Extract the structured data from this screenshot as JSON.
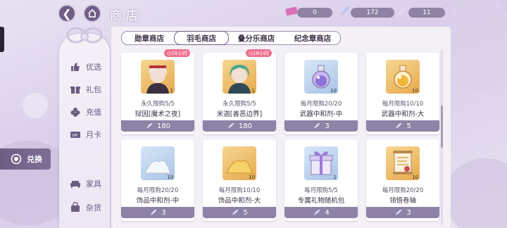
{
  "header": {
    "title": "商店",
    "currencies": [
      {
        "icon": "ticket-icon",
        "value": "0"
      },
      {
        "icon": "feather-icon",
        "value": "172"
      },
      {
        "icon": "star-feather-icon",
        "value": "11"
      }
    ]
  },
  "nav": {
    "items": [
      {
        "label": "优选",
        "icon": "thumb-up-icon"
      },
      {
        "label": "礼包",
        "icon": "gift-icon"
      },
      {
        "label": "充值",
        "icon": "flower-icon"
      },
      {
        "label": "月卡",
        "icon": "vip-card-icon"
      },
      {
        "label": "兑换",
        "icon": "exchange-icon"
      },
      {
        "label": "家具",
        "icon": "sofa-icon"
      },
      {
        "label": "杂货",
        "icon": "bag-icon"
      }
    ],
    "active": "兑换"
  },
  "tabs": [
    "勋章商店",
    "羽毛商店",
    "叠分乐商店",
    "纪念章商店"
  ],
  "active_tab": "羽毛商店",
  "items": [
    {
      "name": "狱因[魔术之夜]",
      "limit": "永久限购5/5",
      "price": "180",
      "qty": "1",
      "badge": "18小时",
      "thumb_icon": "character-portrait-red-icon"
    },
    {
      "name": "米迦[善恶边界]",
      "limit": "永久限购5/5",
      "price": "180",
      "qty": "1",
      "badge": "18小时",
      "thumb_icon": "character-portrait-green-icon"
    },
    {
      "name": "武器中和剂-中",
      "limit": "每月限购20/20",
      "price": "3",
      "qty": "10",
      "badge": "",
      "thumb_icon": "potion-purple-icon"
    },
    {
      "name": "武器中和剂-大",
      "limit": "每月限购10/10",
      "price": "5",
      "qty": "10",
      "badge": "",
      "thumb_icon": "potion-gold-icon"
    },
    {
      "name": "饰品中和剂-中",
      "limit": "每月限购20/20",
      "price": "3",
      "qty": "10",
      "badge": "",
      "thumb_icon": "powder-white-icon"
    },
    {
      "name": "饰品中和剂-大",
      "limit": "每月限购10/10",
      "price": "5",
      "qty": "10",
      "badge": "",
      "thumb_icon": "powder-gold-icon"
    },
    {
      "name": "专属礼物随机包",
      "limit": "每月限购5/5",
      "price": "4",
      "qty": "1",
      "badge": "",
      "thumb_icon": "gift-box-icon"
    },
    {
      "name": "领悟卷轴",
      "limit": "每月限购20/20",
      "price": "3",
      "qty": "10",
      "badge": "",
      "thumb_icon": "scroll-icon"
    }
  ],
  "colors": {
    "accent": "#6c5c83",
    "price_bar": "#8e82a6",
    "badge": "#ef6f8c"
  }
}
